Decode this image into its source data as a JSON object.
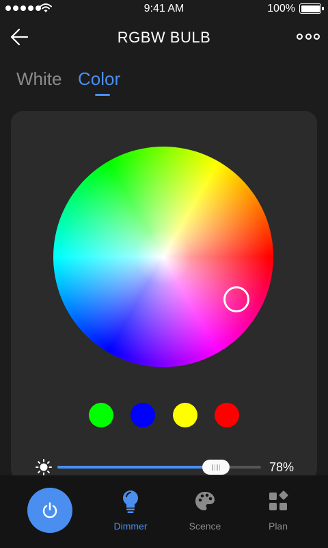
{
  "status_bar": {
    "time": "9:41 AM",
    "battery": "100%"
  },
  "header": {
    "title": "RGBW BULB"
  },
  "mode_tabs": [
    {
      "label": "White"
    },
    {
      "label": "Color"
    }
  ],
  "mode_tabs_active": "Color",
  "swatches": [
    {
      "color": "#00ff00"
    },
    {
      "color": "#0000ff"
    },
    {
      "color": "#ffff00"
    },
    {
      "color": "#ff0000"
    }
  ],
  "brightness": {
    "value": 0.78,
    "label": "78%"
  },
  "nav": [
    {
      "label": "Dimmer",
      "icon": "bulb-icon",
      "active": true
    },
    {
      "label": "Scence",
      "icon": "palette-icon",
      "active": false
    },
    {
      "label": "Plan",
      "icon": "plan-icon",
      "active": false
    }
  ],
  "colors": {
    "accent": "#4a8ff0",
    "card": "#2b2b2b",
    "background": "#1c1c1c"
  }
}
